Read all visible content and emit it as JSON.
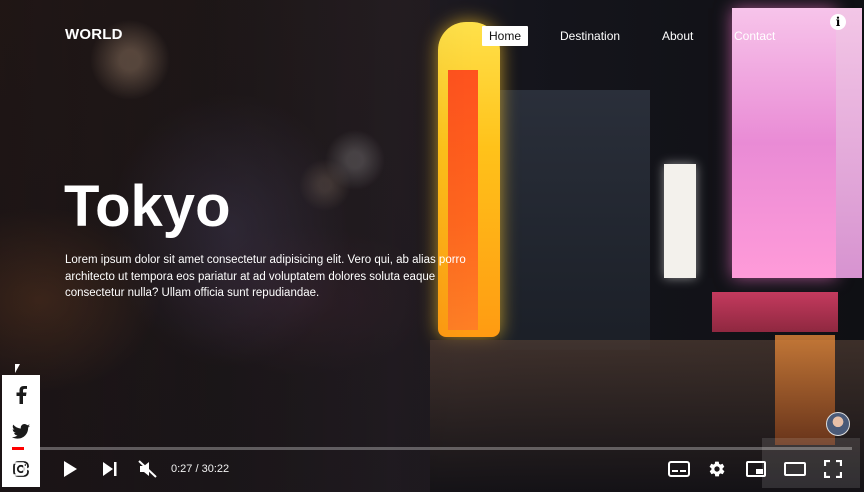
{
  "site": {
    "logo": "WORLD",
    "nav": [
      {
        "label": "Home",
        "active": true
      },
      {
        "label": "Destination",
        "active": false
      },
      {
        "label": "About",
        "active": false
      },
      {
        "label": "Contact",
        "active": false
      }
    ]
  },
  "hero": {
    "title": "Tokyo",
    "description": "Lorem ipsum dolor sit amet consectetur adipisicing elit. Vero qui, ab alias porro architecto ut tempora eos pariatur at ad voluptatem dolores soluta eaque consectetur nulla? Ullam officia sunt repudiandae."
  },
  "social": {
    "items": [
      {
        "icon": "facebook-icon",
        "glyph": "f"
      },
      {
        "icon": "twitter-icon",
        "glyph": "t"
      },
      {
        "icon": "instagram-icon",
        "glyph": "◎"
      }
    ]
  },
  "player": {
    "current_time": "0:27",
    "duration": "30:22",
    "time_display": "0:27 / 30:22",
    "progress_fraction": 0.0148,
    "muted": true,
    "icons": [
      "play-icon",
      "next-icon",
      "mute-icon",
      "subtitles-icon",
      "settings-icon",
      "miniplayer-icon",
      "theater-icon",
      "fullscreen-icon",
      "info-icon"
    ]
  },
  "colors": {
    "accent": "#ff0000",
    "text": "#ffffff",
    "nav_active_bg": "#ffffff"
  }
}
